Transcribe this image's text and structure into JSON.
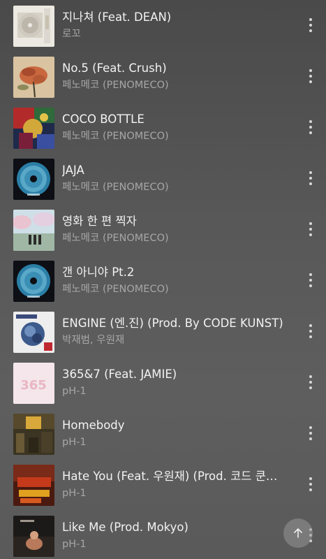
{
  "songs": [
    {
      "title": "지나쳐 (Feat. DEAN)",
      "artist": "로꼬"
    },
    {
      "title": "No.5 (Feat. Crush)",
      "artist": "페노메코 (PENOMECO)"
    },
    {
      "title": "COCO BOTTLE",
      "artist": "페노메코 (PENOMECO)"
    },
    {
      "title": "JAJA",
      "artist": "페노메코 (PENOMECO)"
    },
    {
      "title": "영화 한 편 찍자",
      "artist": "페노메코 (PENOMECO)"
    },
    {
      "title": "갠 아니야 Pt.2",
      "artist": "페노메코 (PENOMECO)"
    },
    {
      "title": "ENGINE (엔.진) (Prod. By CODE KUNST)",
      "artist": "박재범, 우원재"
    },
    {
      "title": "365&7 (Feat. JAMIE)",
      "artist": "pH-1"
    },
    {
      "title": "Homebody",
      "artist": "pH-1"
    },
    {
      "title": "Hate You (Feat. 우원재) (Prod. 코드 쿤스트)",
      "artist": "pH-1"
    },
    {
      "title": "Like Me (Prod. Mokyo)",
      "artist": "pH-1"
    }
  ],
  "icons": {
    "more": "more-vertical-icon",
    "scroll_top": "arrow-up-icon"
  },
  "colors": {
    "background": "#555555",
    "title": "#f2f2f2",
    "artist": "#a6a6a6"
  }
}
